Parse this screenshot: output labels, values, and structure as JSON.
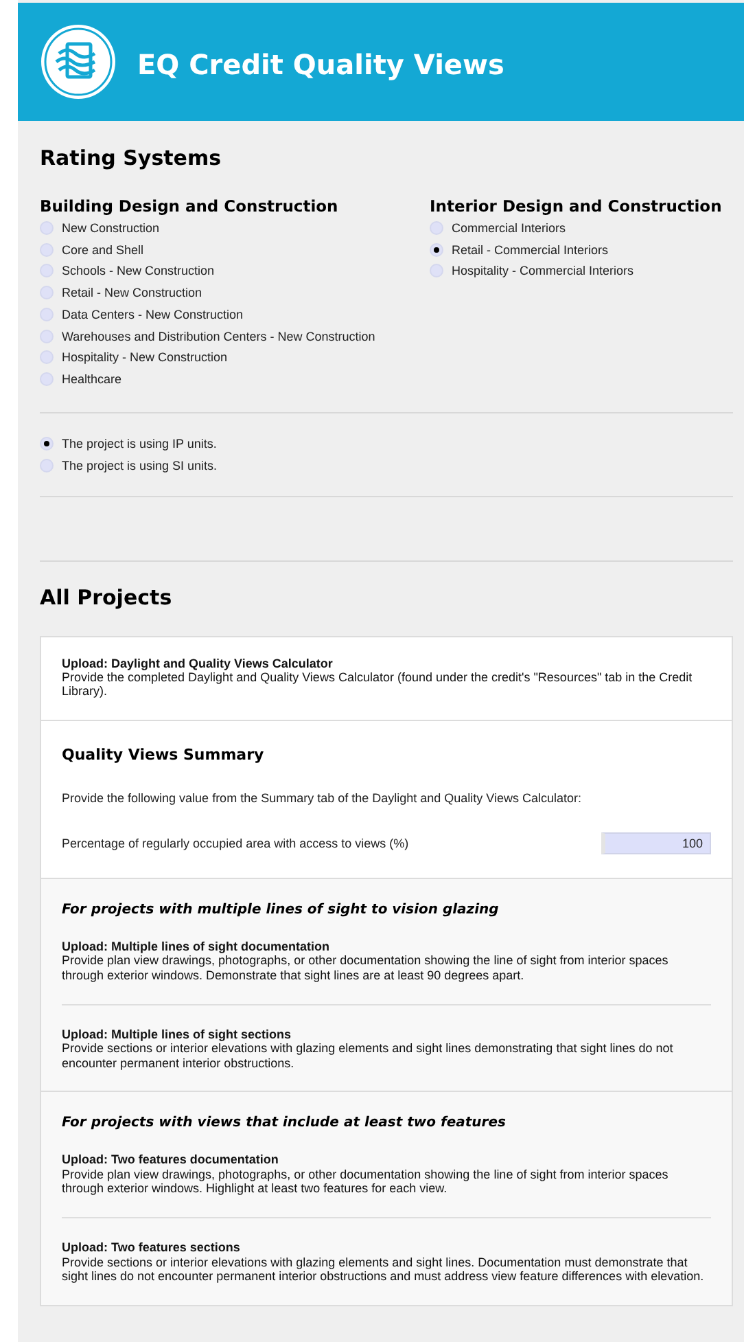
{
  "header": {
    "title": "EQ Credit Quality Views"
  },
  "rating_systems": {
    "title": "Rating Systems",
    "groups": [
      {
        "title": "Building Design and Construction",
        "options": [
          {
            "label": "New Construction",
            "selected": false
          },
          {
            "label": "Core and Shell",
            "selected": false
          },
          {
            "label": "Schools - New Construction",
            "selected": false
          },
          {
            "label": "Retail - New Construction",
            "selected": false
          },
          {
            "label": "Data Centers - New Construction",
            "selected": false
          },
          {
            "label": "Warehouses and Distribution Centers - New Construction",
            "selected": false
          },
          {
            "label": "Hospitality - New Construction",
            "selected": false
          },
          {
            "label": "Healthcare",
            "selected": false
          }
        ]
      },
      {
        "title": "Interior Design and Construction",
        "options": [
          {
            "label": "Commercial Interiors",
            "selected": false
          },
          {
            "label": "Retail - Commercial Interiors",
            "selected": true
          },
          {
            "label": "Hospitality - Commercial Interiors",
            "selected": false
          }
        ]
      }
    ]
  },
  "units": [
    {
      "label": "The project is using IP units.",
      "selected": true
    },
    {
      "label": "The project is using SI units.",
      "selected": false
    }
  ],
  "all_projects": {
    "title": "All Projects",
    "sections": [
      {
        "kind": "uploads",
        "items": [
          {
            "title": "Upload: Daylight and Quality Views Calculator",
            "description": "Provide the completed Daylight and Quality Views Calculator (found under the credit's \"Resources\" tab in the Credit Library)."
          }
        ]
      },
      {
        "kind": "summary",
        "title": "Quality Views Summary",
        "instruction": "Provide the following value from the Summary tab of the Daylight and Quality Views Calculator:",
        "field": {
          "label": "Percentage of regularly occupied area with access to views (%)",
          "value": "100"
        }
      },
      {
        "kind": "group",
        "title": "For projects with multiple lines of sight to vision glazing",
        "items": [
          {
            "title": "Upload: Multiple lines of sight documentation",
            "description": "Provide plan view drawings, photographs, or other documentation showing the line of sight from interior spaces through exterior windows. Demonstrate that sight lines are at least 90 degrees apart."
          },
          {
            "title": "Upload: Multiple lines of sight sections",
            "description": "Provide sections or interior elevations with glazing elements and sight lines demonstrating that sight lines do not encounter permanent interior obstructions."
          }
        ]
      },
      {
        "kind": "group",
        "title": "For projects with views that include at least two features",
        "items": [
          {
            "title": "Upload: Two features documentation",
            "description": "Provide plan view drawings, photographs, or other documentation showing the line of sight from interior spaces through exterior windows. Highlight at least two features for each view."
          },
          {
            "title": "Upload: Two features sections",
            "description": "Provide sections or interior elevations with glazing elements and sight lines. Documentation must demonstrate that sight lines do not encounter permanent interior obstructions and must address view feature differences with elevation."
          }
        ]
      }
    ]
  }
}
